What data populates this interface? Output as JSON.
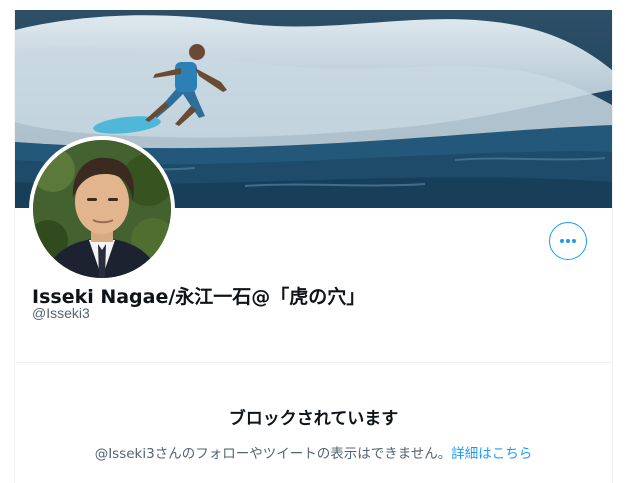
{
  "profile": {
    "display_name": "Isseki Nagae/永江一石@「虎の穴」",
    "handle": "@Isseki3",
    "banner_image": "surfer-riding-wave-photo",
    "avatar_image": "man-in-suit-portrait-photo"
  },
  "actions": {
    "more_icon": "more-horizontal-icon"
  },
  "blocked_notice": {
    "title": "ブロックされています",
    "message": "@Isseki3さんのフォローやツイートの表示はできません。",
    "link_label": "詳細はこちら"
  },
  "colors": {
    "accent": "#1d9bf0",
    "text_primary": "#0f1419",
    "text_secondary": "#536471",
    "divider": "#eff3f4"
  }
}
